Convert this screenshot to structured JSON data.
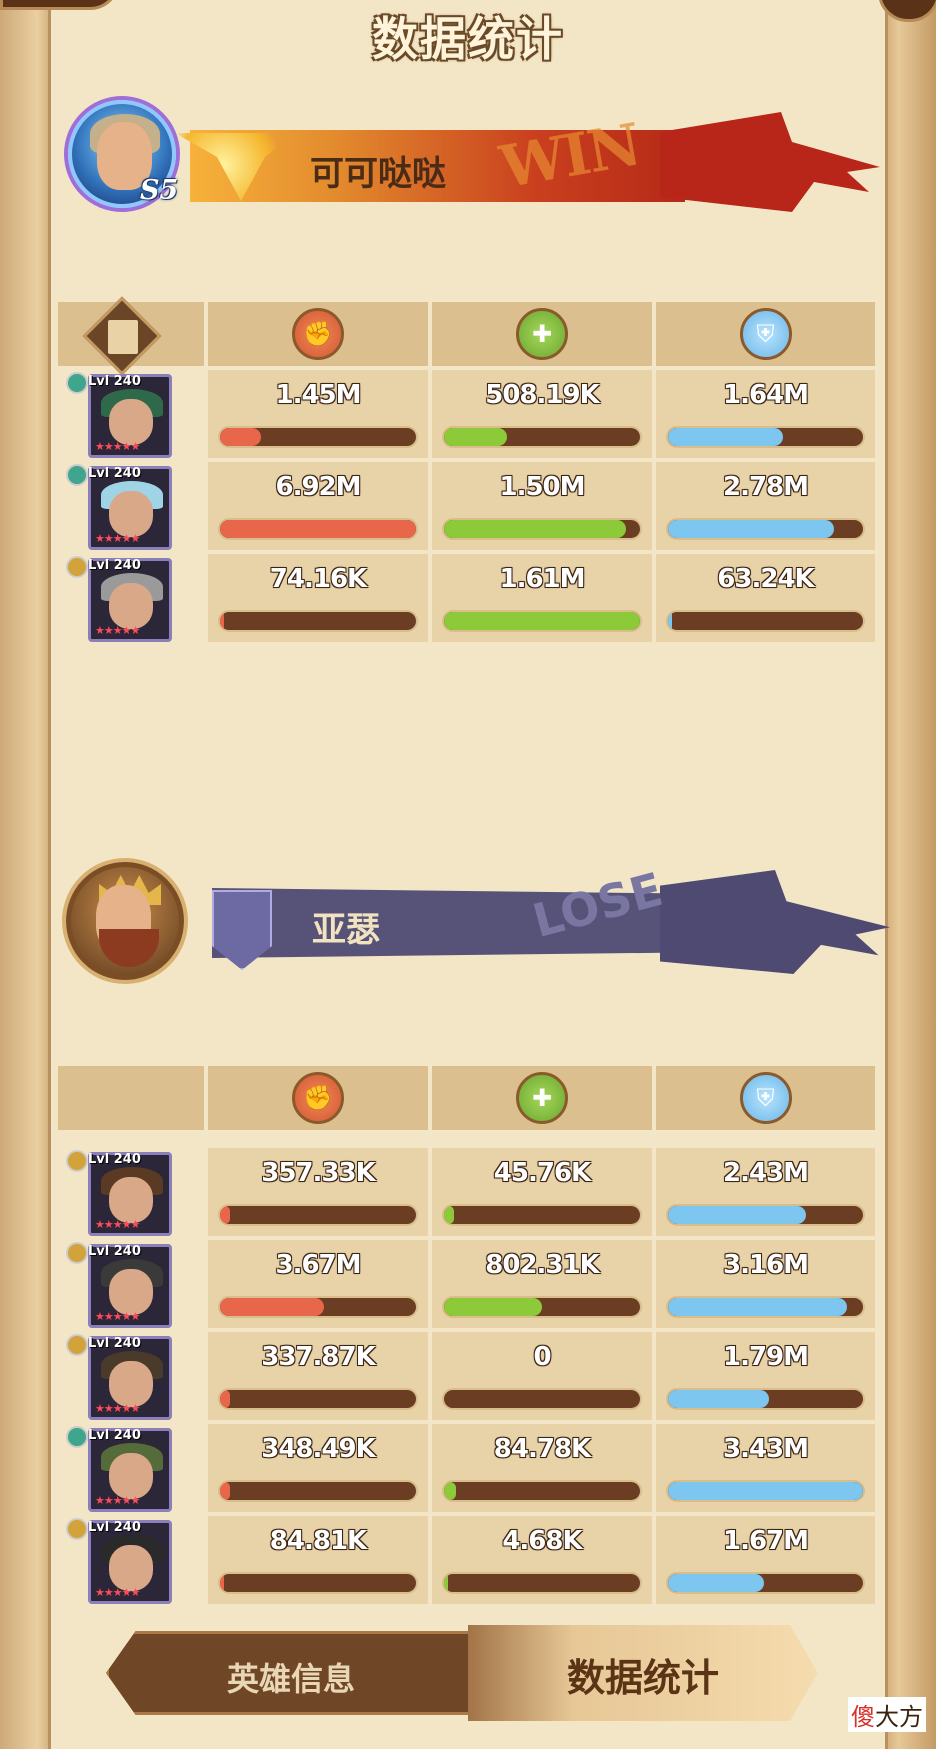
{
  "header": {
    "title": "数据统计"
  },
  "winner": {
    "name": "可可哒哒",
    "rank": "S5",
    "result": "WIN"
  },
  "loser": {
    "name": "亚瑟",
    "result": "LOSE"
  },
  "colors": {
    "damage": "#e8664a",
    "heal": "#8cca3a",
    "shield": "#7cc6ef"
  },
  "column_icons": [
    "damage-icon",
    "heal-icon",
    "shield-icon"
  ],
  "team1": [
    {
      "level": "Lvl 240",
      "damage": "1.45M",
      "heal": "508.19K",
      "shield": "1.64M",
      "damage_frac": 0.21,
      "heal_frac": 0.32,
      "shield_frac": 0.59
    },
    {
      "level": "Lvl 240",
      "damage": "6.92M",
      "heal": "1.50M",
      "shield": "2.78M",
      "damage_frac": 1.0,
      "heal_frac": 0.93,
      "shield_frac": 0.85
    },
    {
      "level": "Lvl 240",
      "damage": "74.16K",
      "heal": "1.61M",
      "shield": "63.24K",
      "damage_frac": 0.01,
      "heal_frac": 1.0,
      "shield_frac": 0.02
    }
  ],
  "team2": [
    {
      "level": "Lvl 240",
      "damage": "357.33K",
      "heal": "45.76K",
      "shield": "2.43M",
      "damage_frac": 0.05,
      "heal_frac": 0.05,
      "shield_frac": 0.71
    },
    {
      "level": "Lvl 240",
      "damage": "3.67M",
      "heal": "802.31K",
      "shield": "3.16M",
      "damage_frac": 0.53,
      "heal_frac": 0.5,
      "shield_frac": 0.92
    },
    {
      "level": "Lvl 240",
      "damage": "337.87K",
      "heal": "0",
      "shield": "1.79M",
      "damage_frac": 0.05,
      "heal_frac": 0.0,
      "shield_frac": 0.52
    },
    {
      "level": "Lvl 240",
      "damage": "348.49K",
      "heal": "84.78K",
      "shield": "3.43M",
      "damage_frac": 0.05,
      "heal_frac": 0.06,
      "shield_frac": 1.0
    },
    {
      "level": "Lvl 240",
      "damage": "84.81K",
      "heal": "4.68K",
      "shield": "1.67M",
      "damage_frac": 0.01,
      "heal_frac": 0.01,
      "shield_frac": 0.49
    }
  ],
  "tabs": {
    "hero_info": "英雄信息",
    "stats": "数据统计"
  },
  "watermark": {
    "accent": "傻",
    "rest": "大方"
  }
}
